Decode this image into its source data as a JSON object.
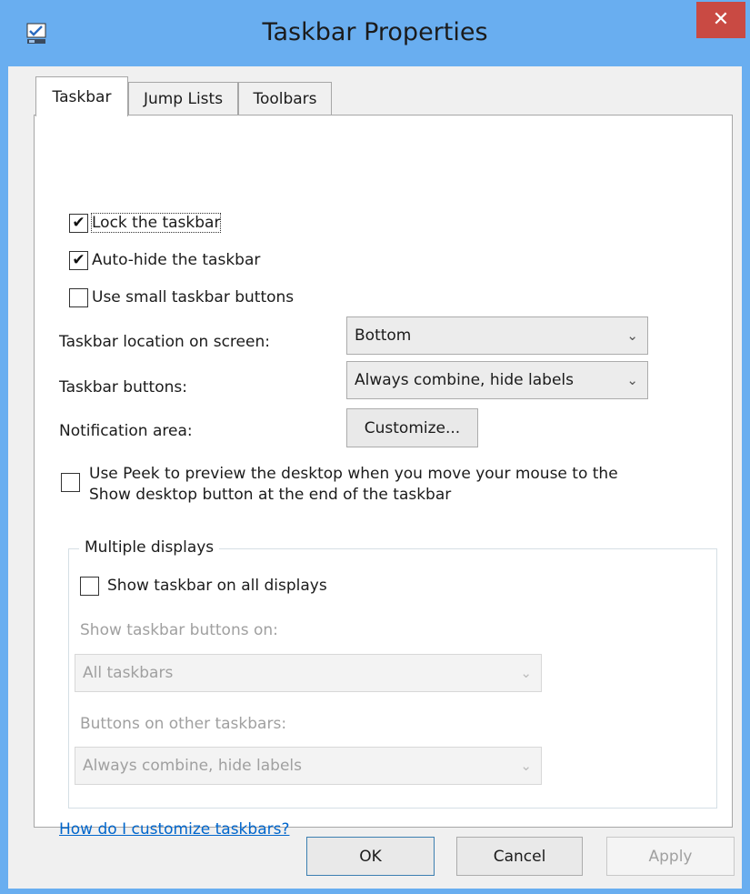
{
  "window": {
    "title": "Taskbar Properties"
  },
  "titlebar": {
    "close_glyph": "✕"
  },
  "tabs": [
    {
      "label": "Taskbar"
    },
    {
      "label": "Jump Lists"
    },
    {
      "label": "Toolbars"
    }
  ],
  "taskbar": {
    "lock": {
      "label": "Lock the taskbar",
      "checked": true
    },
    "autohide": {
      "label": "Auto-hide the taskbar",
      "checked": true
    },
    "small_buttons": {
      "label": "Use small taskbar buttons",
      "checked": false
    },
    "location": {
      "label": "Taskbar location on screen:",
      "value": "Bottom"
    },
    "buttons": {
      "label": "Taskbar buttons:",
      "value": "Always combine, hide labels"
    },
    "notification": {
      "label": "Notification area:",
      "button": "Customize..."
    },
    "peek": {
      "label_line1": "Use Peek to preview the desktop when you move your mouse to the",
      "label_line2": "Show desktop button at the end of the taskbar",
      "checked": false
    }
  },
  "multiple_displays": {
    "title": "Multiple displays",
    "show_all": {
      "label": "Show taskbar on all displays",
      "checked": false
    },
    "buttons_on_label": "Show taskbar buttons on:",
    "buttons_on_value": "All taskbars",
    "other_label": "Buttons on other taskbars:",
    "other_value": "Always combine, hide labels"
  },
  "help_link": "How do I customize taskbars?",
  "footer": {
    "ok": "OK",
    "cancel": "Cancel",
    "apply": "Apply"
  },
  "glyphs": {
    "check": "✔",
    "chevron": "⌄"
  },
  "colors": {
    "titlebar": "#69aef0",
    "close": "#c94a43",
    "link": "#0066cc"
  }
}
